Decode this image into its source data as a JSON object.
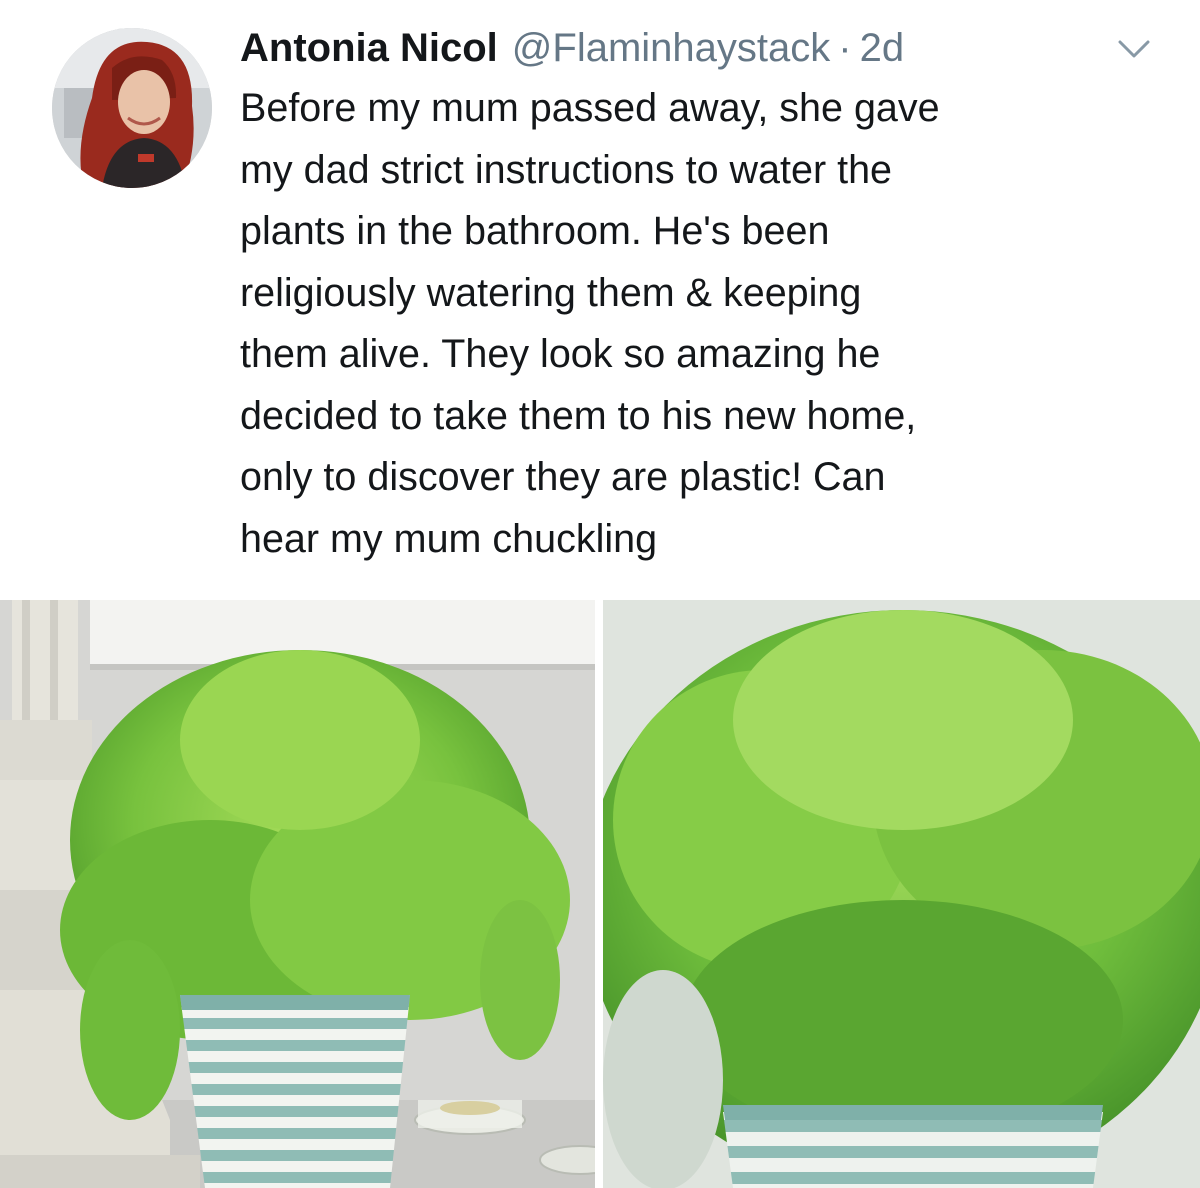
{
  "tweet": {
    "author_name": "Antonia Nicol",
    "handle": "@Flaminhaystack",
    "separator": "·",
    "time": "2d",
    "text": "Before my mum passed away, she gave\nmy dad strict instructions to water the\nplants in the bathroom. He's been\nreligiously watering them & keeping\nthem alive. They look so amazing he\ndecided to take them to his new home,\nonly to discover they are plastic! Can\nhear my mum chuckling"
  },
  "icons": {
    "caret": "chevron-down-icon"
  },
  "colors": {
    "text": "#14171a",
    "secondary": "#657786",
    "plant_green": "#7cc242",
    "pot_stripe": "#8fbcb5"
  }
}
